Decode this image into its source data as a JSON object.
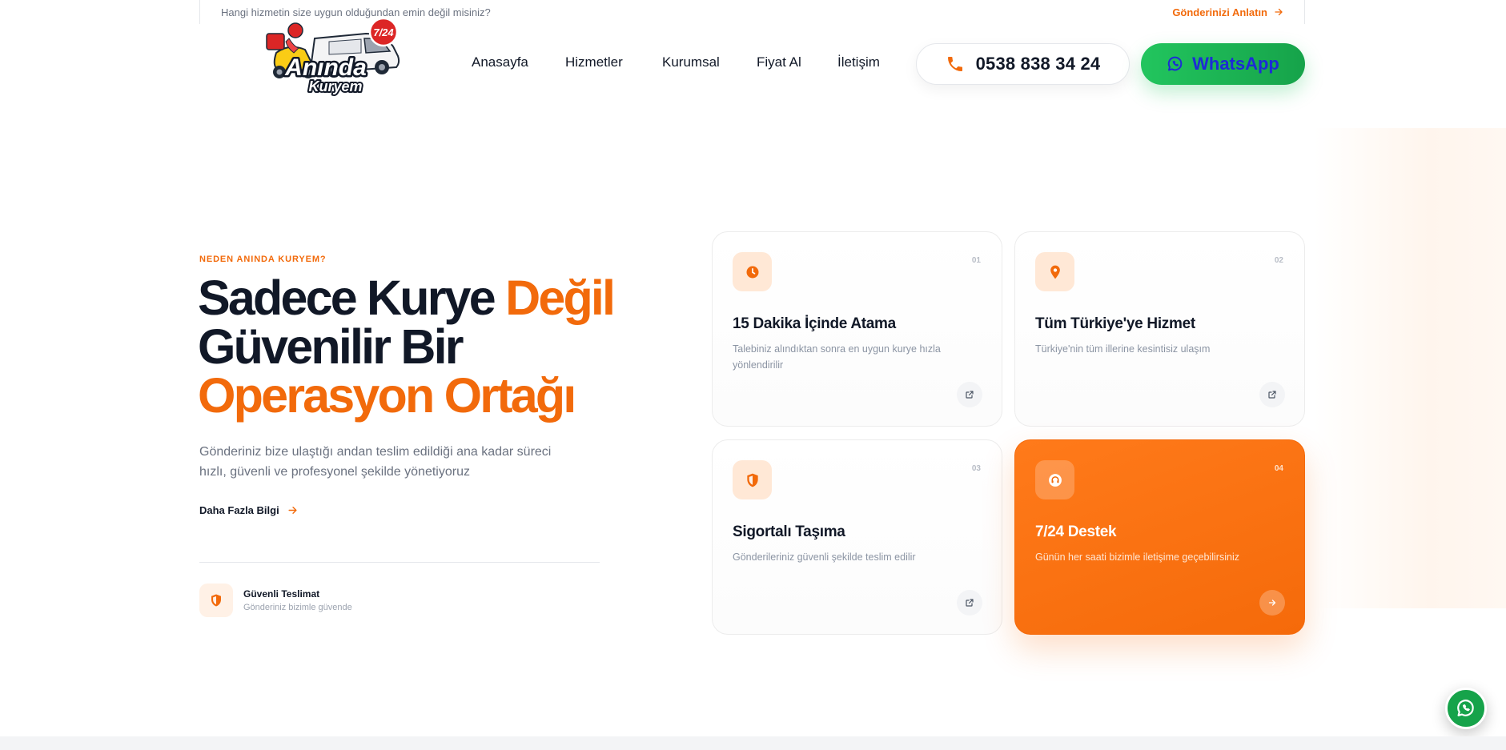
{
  "helpbar": {
    "question": "Hangi hizmetin size uygun olduğundan emin değil misiniz?",
    "cta": "Gönderinizi Anlatın"
  },
  "brand": {
    "logo_top": "Anında",
    "logo_bottom": "Kuryem",
    "logo_badge": "7/24"
  },
  "nav": {
    "items": [
      "Anasayfa",
      "Hizmetler",
      "Kurumsal",
      "Fiyat Al",
      "İletişim"
    ]
  },
  "header": {
    "phone": "0538 838 34 24",
    "whatsapp": "WhatsApp"
  },
  "hero": {
    "eyebrow": "NEDEN ANINDA KURYEM?",
    "line1_dark": "Sadece Kurye",
    "line1_orange": "Değil",
    "line2_dark": "Güvenilir Bir",
    "line3_orange": "Operasyon Ortağı",
    "lead": "Gönderiniz bize ulaştığı andan teslim edildiği ana kadar süreci hızlı, güvenli ve profesyonel şekilde yönetiyoruz",
    "more": "Daha Fazla Bilgi"
  },
  "feature": {
    "title": "Güvenli Teslimat",
    "subtitle": "Gönderiniz bizimle güvende"
  },
  "cards": [
    {
      "index": "01",
      "icon": "clock-icon",
      "title": "15 Dakika İçinde Atama",
      "desc": "Talebiniz alındıktan sonra en uygun kurye hızla yönlendirilir"
    },
    {
      "index": "02",
      "icon": "map-pin-icon",
      "title": "Tüm Türkiye'ye Hizmet",
      "desc": "Türkiye'nin tüm illerine kesintisiz ulaşım"
    },
    {
      "index": "03",
      "icon": "shield-icon",
      "title": "Sigortalı Taşıma",
      "desc": "Gönderileriniz güvenli şekilde teslim edilir"
    },
    {
      "index": "04",
      "icon": "headset-icon",
      "title": "7/24 Destek",
      "desc": "Günün her saati bizimle iletişime geçebilirsiniz"
    }
  ],
  "colors": {
    "accent": "#f26a0b",
    "whatsapp_green": "#22c55e",
    "text_dark": "#111827",
    "muted": "#6b7280"
  }
}
